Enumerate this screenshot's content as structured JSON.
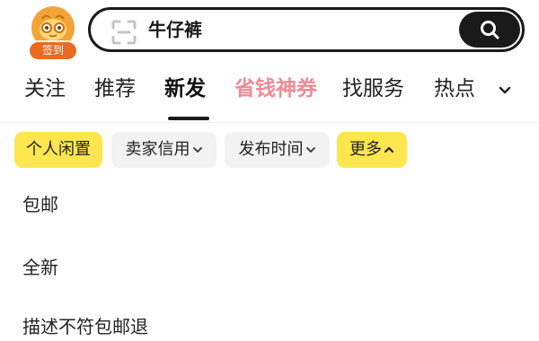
{
  "signin": {
    "label": "签到"
  },
  "search": {
    "query": "牛仔裤"
  },
  "tabs": [
    {
      "label": "关注"
    },
    {
      "label": "推荐"
    },
    {
      "label": "新发"
    },
    {
      "label": "省钱神券"
    },
    {
      "label": "找服务"
    },
    {
      "label": "热点"
    }
  ],
  "active_tab": "新发",
  "filters": [
    {
      "label": "个人闲置"
    },
    {
      "label": "卖家信用"
    },
    {
      "label": "发布时间"
    },
    {
      "label": "更多"
    }
  ],
  "options": [
    {
      "label": "包邮"
    },
    {
      "label": "全新"
    },
    {
      "label": "描述不符包邮退"
    }
  ],
  "colors": {
    "promo_tab": "#ee8a94",
    "highlight_chip": "#fde64e",
    "signin_orange": "#ea6a22"
  },
  "icons": [
    "sign-in-mascot-icon",
    "scan-icon",
    "search-icon",
    "chevron-down-icon",
    "chevron-up-icon"
  ]
}
